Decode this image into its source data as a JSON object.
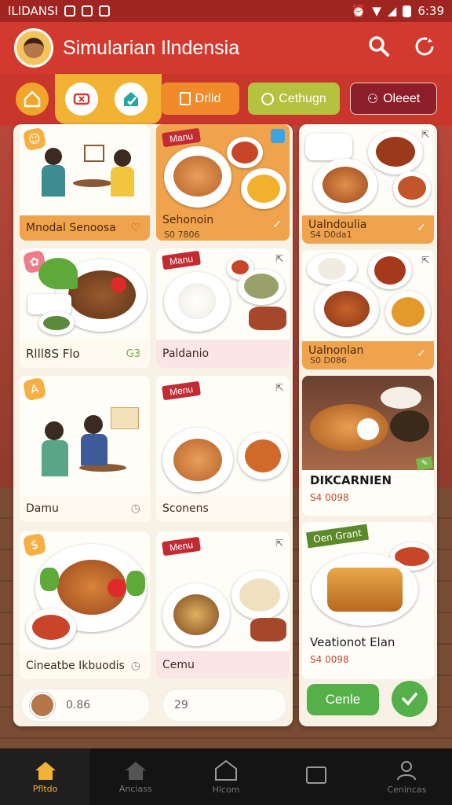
{
  "status": {
    "time": "6:39",
    "left_text": "ILIDANSI"
  },
  "app": {
    "title": "Simularian Ilndensia"
  },
  "filters": {
    "pill1": "Drlld",
    "pill2": "Cethugn",
    "pill3": "Oleeet"
  },
  "cards": {
    "c1": {
      "title": "Mnodal Senoosa"
    },
    "c2": {
      "tag": "Manu",
      "title": "Sehonoin",
      "sub": "S0 7806"
    },
    "c3": {
      "title": "Rlll8S Flo",
      "badge": "G3"
    },
    "c4": {
      "tag": "Manu",
      "title": "Paldanio"
    },
    "c5": {
      "title": "Damu"
    },
    "c6": {
      "tag": "Menu",
      "title": "Sconens"
    },
    "c7": {
      "title": "Cineatbe Ikbuodis"
    },
    "c8": {
      "tag": "Menu",
      "title": "Cemu"
    },
    "r1": {
      "title": "Ualndoulia",
      "sub": "S4 D0da1"
    },
    "r2": {
      "title": "Ualnonlan",
      "sub": "S0 D086"
    },
    "r3": {
      "title": "DIKCARNIEN",
      "sub": "S4 0098"
    },
    "r4": {
      "tag": "Oen Grant",
      "title": "Veationot Elan",
      "sub": "S4 0098"
    }
  },
  "footer": {
    "count_left": "0.86",
    "count_right": "29",
    "action": "Cenle"
  },
  "nav": [
    {
      "label": "Pfltdo"
    },
    {
      "label": "Anciass"
    },
    {
      "label": "Hlcom"
    },
    {
      "label": ""
    },
    {
      "label": "Cenincas"
    }
  ],
  "colors": {
    "brand": "#d33a2f",
    "accent": "#f2b233",
    "green": "#55b04a"
  }
}
